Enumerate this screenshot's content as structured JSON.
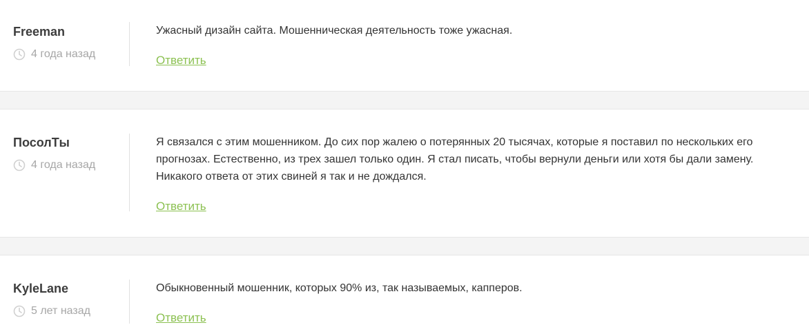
{
  "comments": [
    {
      "author": "Freeman",
      "time": "4 года назад",
      "text": "Ужасный дизайн сайта. Мошенническая деятельность тоже ужасная.",
      "reply_label": "Ответить"
    },
    {
      "author": "ПосолТы",
      "time": "4 года назад",
      "text": "Я связался с этим мошенником. До сих пор жалею о потерянных 20 тысячах, которые я поставил по нескольких его прогнозах. Естественно, из трех зашел только один. Я стал писать, чтобы вернули деньги или хотя бы дали замену. Никакого ответа от этих свиней я так и не дождался.",
      "reply_label": "Ответить"
    },
    {
      "author": "KyleLane",
      "time": "5 лет назад",
      "text": "Обыкновенный мошенник, которых 90% из, так называемых, капперов.",
      "reply_label": "Ответить"
    }
  ],
  "colors": {
    "reply_link": "#8cc152",
    "author": "#3d3d3d",
    "meta": "#a6a6a6",
    "separator": "#f4f4f4"
  },
  "icons": {
    "time": "clock-icon"
  }
}
